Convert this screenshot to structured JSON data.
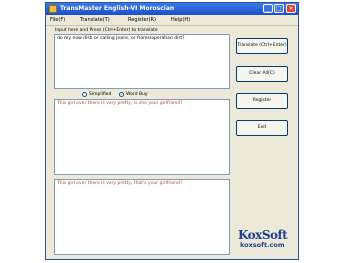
{
  "window": {
    "title": "TransMaster English-VI Moroscian",
    "minimize_glyph": "_",
    "maximize_glyph": "□",
    "close_glyph": "×"
  },
  "menu": [
    {
      "label": "File(F)"
    },
    {
      "label": "Translate(T)"
    },
    {
      "label": "Register(R)"
    },
    {
      "label": "Help(H)"
    }
  ],
  "input": {
    "prompt": "Input here and Press (Ctrl+Enter) to translate",
    "value": "do my now dish or calling jeans, or froms/operation dirt?"
  },
  "mode": {
    "options": [
      "Simplified",
      "Word Buy"
    ],
    "selected_index": 1
  },
  "output": {
    "translation": "This girl over there is very pretty, is she your girlfriend?",
    "preview": "This girl over there is very pretty, that's your girlfriend?"
  },
  "buttons": {
    "translate": "Translate (Ctrl+Enter)",
    "clear": "Clear All(C)",
    "register": "Register",
    "exit": "Exit"
  },
  "logo": {
    "main": "KoxSoft",
    "sub": "koxsoft.com"
  },
  "colors": {
    "title_bar": "#1a4fc9",
    "output_border": "#b04040",
    "logo": "#1f3f8f"
  }
}
